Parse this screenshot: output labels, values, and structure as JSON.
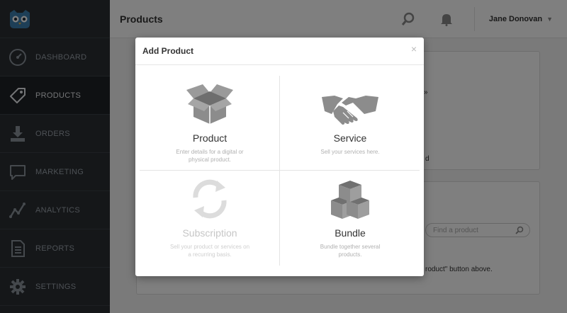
{
  "header": {
    "title": "Products",
    "user_name": "Jane Donovan"
  },
  "sidebar": {
    "items": [
      {
        "label": "DASHBOARD",
        "icon": "gauge-icon"
      },
      {
        "label": "PRODUCTS",
        "icon": "tag-icon",
        "active": true
      },
      {
        "label": "ORDERS",
        "icon": "download-tray-icon"
      },
      {
        "label": "MARKETING",
        "icon": "speech-bubble-icon"
      },
      {
        "label": "ANALYTICS",
        "icon": "line-chart-icon"
      },
      {
        "label": "REPORTS",
        "icon": "document-icon"
      },
      {
        "label": "SETTINGS",
        "icon": "gear-icon"
      }
    ]
  },
  "background": {
    "snippet_1": "»",
    "snippet_2": "d",
    "search_placeholder": "Find a product",
    "snippet_3": "roduct\" button above."
  },
  "modal": {
    "title": "Add Product",
    "close": "×",
    "options": [
      {
        "name": "Product",
        "description": "Enter details for a digital or physical product.",
        "enabled": true,
        "icon": "open-box-icon"
      },
      {
        "name": "Service",
        "description": "Sell your services here.",
        "enabled": true,
        "icon": "handshake-icon"
      },
      {
        "name": "Subscription",
        "description": "Sell your product or services on a recurring basis.",
        "enabled": false,
        "icon": "refresh-cycle-icon"
      },
      {
        "name": "Bundle",
        "description": "Bundle together several products.",
        "enabled": true,
        "icon": "stacked-boxes-icon"
      }
    ]
  },
  "colors": {
    "sidebar_bg": "#2a2e33",
    "icon_gray": "#8c8c8c",
    "overlay": "rgba(0,0,0,0.5)"
  }
}
